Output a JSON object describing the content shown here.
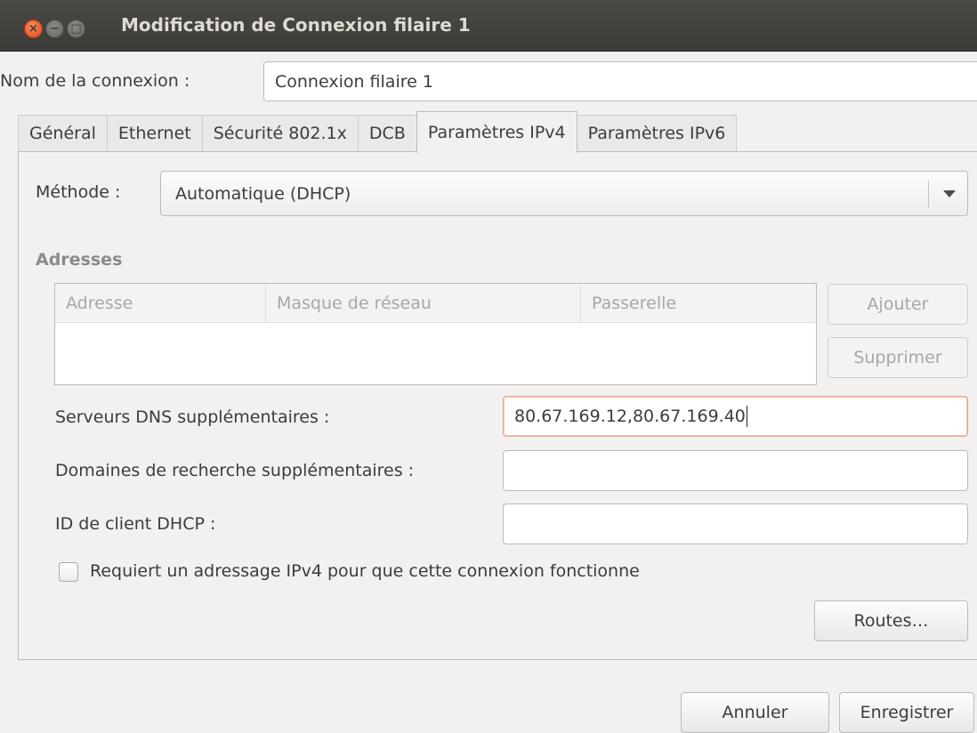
{
  "window": {
    "title": "Modification de Connexion filaire 1",
    "close_glyph": "×",
    "minimize_glyph": "−",
    "maximize_glyph": "□"
  },
  "connection": {
    "name_label": "Nom de la connexion :",
    "name_value": "Connexion filaire 1"
  },
  "tabs": [
    {
      "label": "Général",
      "active": false
    },
    {
      "label": "Ethernet",
      "active": false
    },
    {
      "label": "Sécurité 802.1x",
      "active": false
    },
    {
      "label": "DCB",
      "active": false
    },
    {
      "label": "Paramètres IPv4",
      "active": true
    },
    {
      "label": "Paramètres IPv6",
      "active": false
    }
  ],
  "ipv4": {
    "method_label": "Méthode :",
    "method_value": "Automatique (DHCP)",
    "addresses_title": "Adresses",
    "columns": [
      "Adresse",
      "Masque de réseau",
      "Passerelle"
    ],
    "add_label": "Ajouter",
    "remove_label": "Supprimer",
    "dns_label": "Serveurs DNS supplémentaires :",
    "dns_value": "80.67.169.12,80.67.169.40",
    "search_label": "Domaines de recherche supplémentaires :",
    "search_value": "",
    "dhcp_id_label": "ID de client DHCP :",
    "dhcp_id_value": "",
    "require_label": "Requiert un adressage IPv4 pour que cette connexion fonctionne",
    "require_checked": false,
    "routes_label": "Routes…"
  },
  "footer": {
    "cancel_label": "Annuler",
    "save_label": "Enregistrer"
  },
  "colors": {
    "titlebar": "#3c3b37",
    "close_button": "#df4a16",
    "focus_border": "#e8a58a",
    "window_bg": "#f2f1f0"
  }
}
